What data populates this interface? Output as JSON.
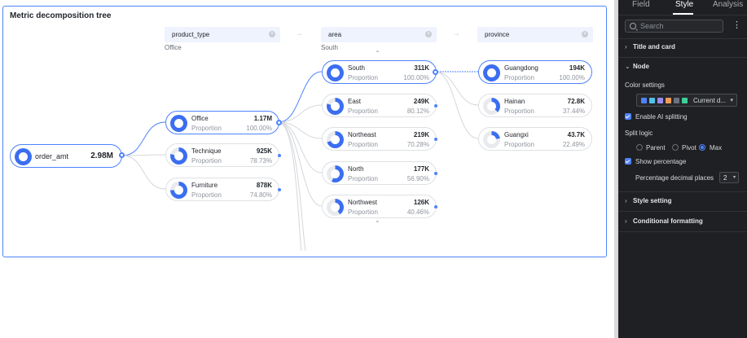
{
  "card": {
    "title": "Metric decomposition tree"
  },
  "columns": [
    {
      "header": "product_type",
      "sub": "Office"
    },
    {
      "header": "area",
      "sub": "South"
    },
    {
      "header": "province",
      "sub": ""
    }
  ],
  "root": {
    "name": "order_amt",
    "value": "2.98M"
  },
  "proportion_label": "Proportion",
  "product_nodes": [
    {
      "name": "Office",
      "value": "1.17M",
      "pct": "100.00%",
      "fill": 1.0,
      "selected": true
    },
    {
      "name": "Technique",
      "value": "925K",
      "pct": "78.73%",
      "fill": 0.7873
    },
    {
      "name": "Furniture",
      "value": "878K",
      "pct": "74.80%",
      "fill": 0.748
    }
  ],
  "area_nodes": [
    {
      "name": "South",
      "value": "311K",
      "pct": "100.00%",
      "fill": 1.0,
      "selected": true
    },
    {
      "name": "East",
      "value": "249K",
      "pct": "80.12%",
      "fill": 0.8012
    },
    {
      "name": "Northeast",
      "value": "219K",
      "pct": "70.28%",
      "fill": 0.7028
    },
    {
      "name": "North",
      "value": "177K",
      "pct": "56.90%",
      "fill": 0.569
    },
    {
      "name": "Northwest",
      "value": "126K",
      "pct": "40.46%",
      "fill": 0.4046
    }
  ],
  "province_nodes": [
    {
      "name": "Guangdong",
      "value": "194K",
      "pct": "100.00%",
      "fill": 1.0,
      "selected": true
    },
    {
      "name": "Hainan",
      "value": "72.8K",
      "pct": "37.44%",
      "fill": 0.3744
    },
    {
      "name": "Guangxi",
      "value": "43.7K",
      "pct": "22.49%",
      "fill": 0.2249
    }
  ],
  "colors": {
    "accent": "#4e83fd",
    "ring": "#3b6ef0",
    "ring_track": "#e8eaed"
  },
  "panel": {
    "tabs": [
      "Field",
      "Style",
      "Analysis"
    ],
    "active_tab": "Style",
    "search_placeholder": "Search",
    "sections": {
      "title_and_card": "Title and card",
      "node": "Node",
      "style_setting": "Style setting",
      "conditional_formatting": "Conditional formatting"
    },
    "color_settings_label": "Color settings",
    "color_scheme": "Current d...",
    "swatch_colors": [
      "#4e83fd",
      "#52c0e8",
      "#9b8cf2",
      "#f39a57",
      "#6b7280",
      "#3ecf9a"
    ],
    "enable_ai_splitting": "Enable AI splitting",
    "split_logic_label": "Split logic",
    "split_options": [
      "Parent",
      "Pivot",
      "Max"
    ],
    "split_selected": "Max",
    "show_percentage": "Show percentage",
    "decimal_places_label": "Percentage decimal places",
    "decimal_places_value": "2"
  }
}
